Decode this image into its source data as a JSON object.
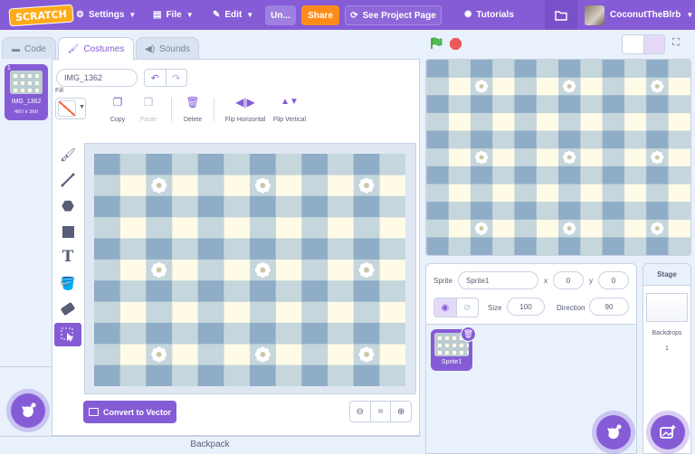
{
  "menubar": {
    "logo": "SCRATCH",
    "settings": "Settings",
    "file": "File",
    "edit": "Edit",
    "project_title": "Un...",
    "share": "Share",
    "see_project_page": "See Project Page",
    "tutorials": "Tutorials",
    "username": "CoconutTheBlrb"
  },
  "tabs": {
    "code": "Code",
    "costumes": "Costumes",
    "sounds": "Sounds"
  },
  "costume_list": [
    {
      "number": "1",
      "name": "IMG_1362",
      "size": "480 x 360"
    }
  ],
  "editor": {
    "costume_name": "IMG_1362",
    "fill_label": "Fill",
    "actions": {
      "copy": "Copy",
      "paste": "Paste",
      "delete": "Delete",
      "flip_horizontal": "Flip Horizontal",
      "flip_vertical": "Flip Vertical"
    },
    "convert": "Convert to Vector",
    "zoom_reset": "="
  },
  "backpack": "Backpack",
  "sprite_info": {
    "sprite_label": "Sprite",
    "sprite_name": "Sprite1",
    "x_label": "x",
    "x_value": "0",
    "y_label": "y",
    "y_value": "0",
    "size_label": "Size",
    "size_value": "100",
    "direction_label": "Direction",
    "direction_value": "90"
  },
  "sprites": [
    {
      "name": "Sprite1"
    }
  ],
  "stage_selector": {
    "title": "Stage",
    "backdrops_label": "Backdrops",
    "backdrops_count": "1"
  },
  "colors": {
    "accent": "#855cd6",
    "menubar": "#855cd6",
    "share": "#ff8c1a",
    "gingham_light": "#fffbe6",
    "gingham_mid": "#c5d6dc",
    "gingham_dark": "#8fadc6"
  },
  "icons": [
    "gear-icon",
    "file-icon",
    "pencil-icon",
    "refresh-icon",
    "bulb-icon",
    "folder-icon",
    "brush-icon",
    "line-icon",
    "circle-icon",
    "rectangle-icon",
    "text-icon",
    "fill-icon",
    "eraser-icon",
    "select-icon",
    "undo-icon",
    "redo-icon",
    "copy-icon",
    "paste-icon",
    "trash-icon",
    "flip-horizontal-icon",
    "flip-vertical-icon",
    "zoom-out-icon",
    "zoom-in-icon",
    "green-flag-icon",
    "stop-icon",
    "fullscreen-icon",
    "eye-icon",
    "eye-off-icon",
    "cat-add-icon"
  ]
}
